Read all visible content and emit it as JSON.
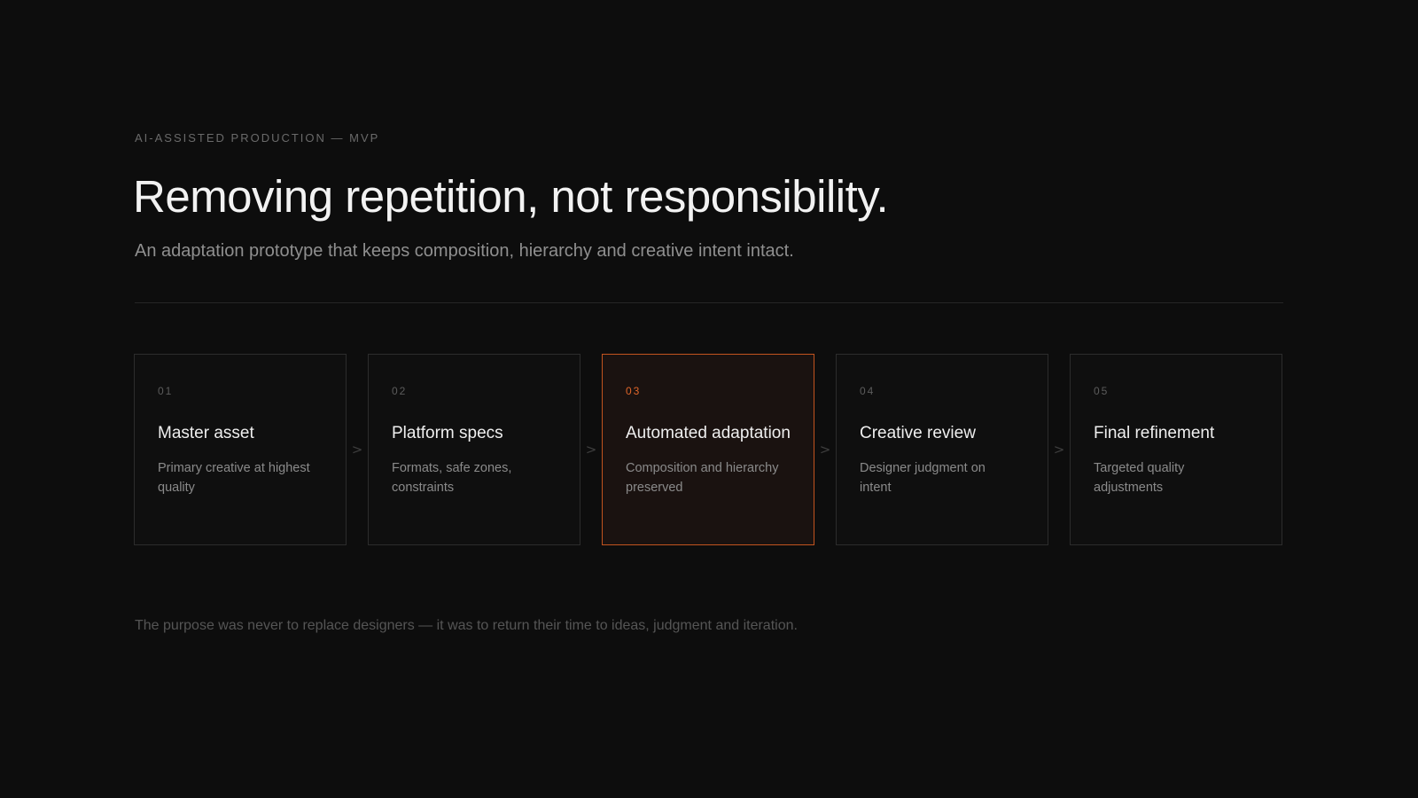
{
  "eyebrow": "AI-ASSISTED PRODUCTION — MVP",
  "headline": "Removing repetition, not responsibility.",
  "subtitle": "An adaptation prototype that keeps composition, hierarchy and creative intent intact.",
  "steps": [
    {
      "num": "01",
      "title": "Master asset",
      "desc": "Primary creative at highest quality"
    },
    {
      "num": "02",
      "title": "Platform specs",
      "desc": "Formats, safe zones, constraints"
    },
    {
      "num": "03",
      "title": "Automated adaptation",
      "desc": "Composition and hierarchy preserved",
      "active": true
    },
    {
      "num": "04",
      "title": "Creative review",
      "desc": "Designer judgment on intent"
    },
    {
      "num": "05",
      "title": "Final refinement",
      "desc": "Targeted quality adjustments"
    }
  ],
  "arrow_glyph": ">",
  "footer_note": "The purpose was never to replace designers — it was to return their time to ideas, judgment and iteration.",
  "colors": {
    "background": "#0d0d0d",
    "accent": "#e0662a",
    "accent_border": "#c2541f"
  }
}
